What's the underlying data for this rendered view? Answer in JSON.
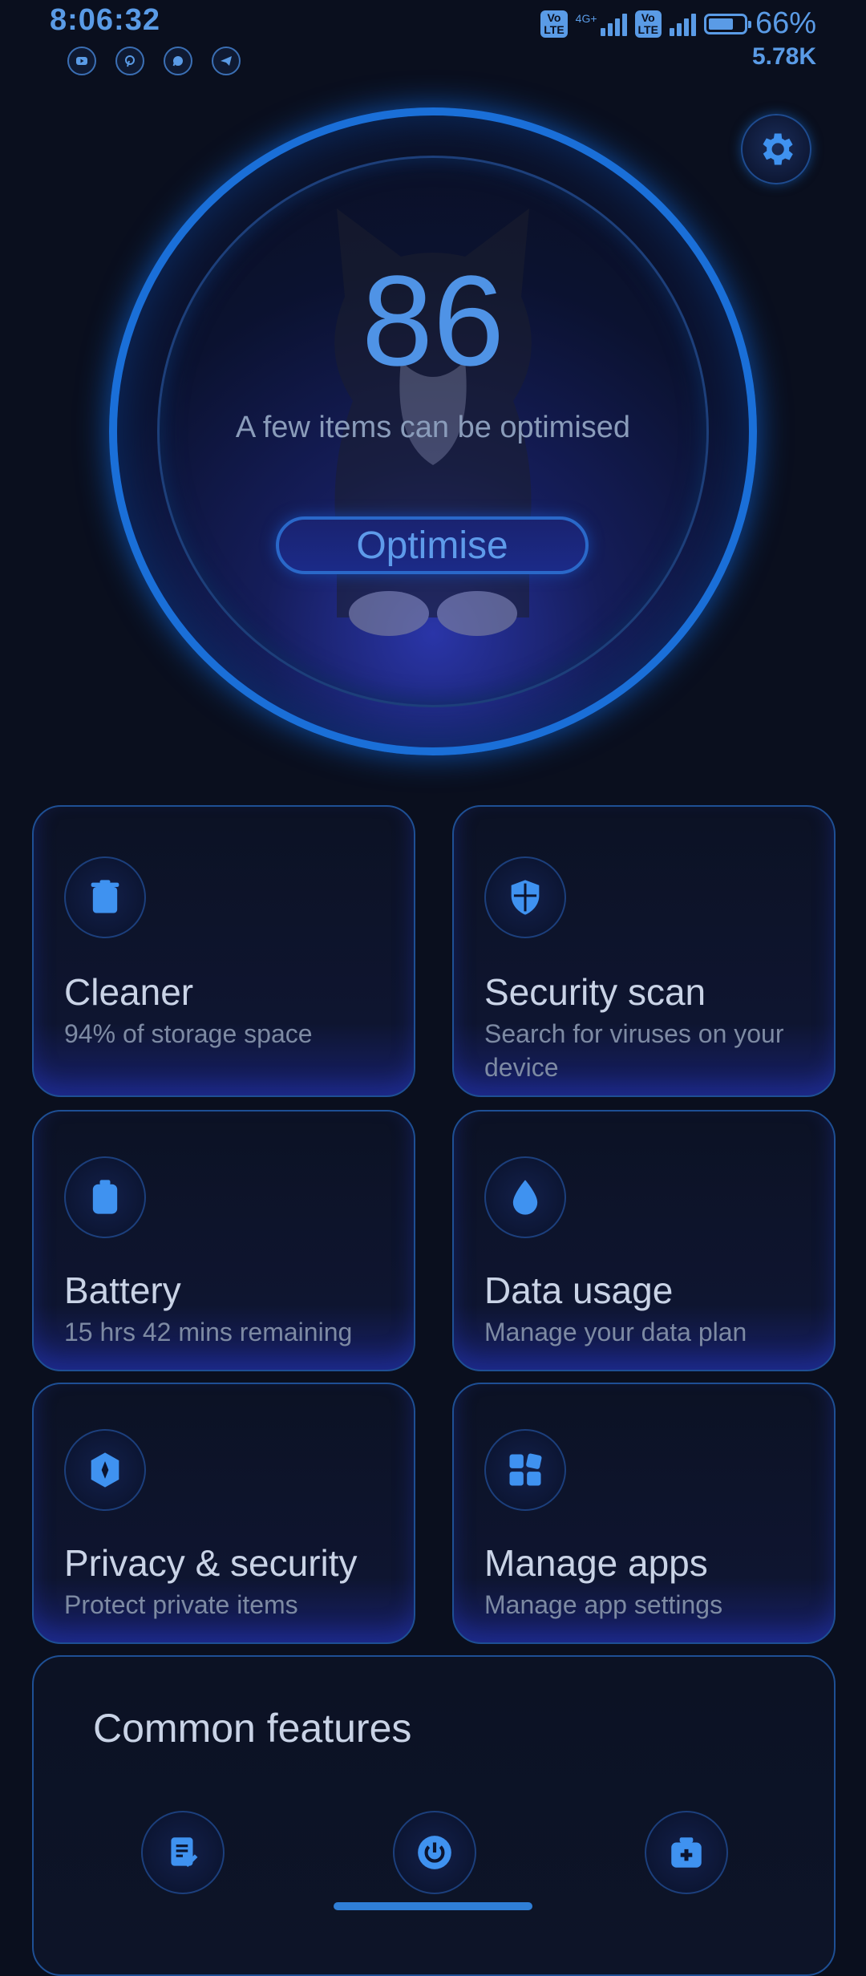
{
  "status_bar": {
    "time": "8:06:32",
    "network_type": "4G+",
    "volte_label": "Vo LTE",
    "battery_percent": "66%",
    "net_speed": "5.78K",
    "notification_icons": [
      "youtube-icon",
      "pinterest-icon",
      "whatsapp-icon",
      "telegram-icon"
    ]
  },
  "score": {
    "value": "86",
    "message": "A few items can be optimised",
    "button_label": "Optimise"
  },
  "cards": [
    {
      "title": "Cleaner",
      "subtitle": "94% of storage space",
      "icon": "trash-icon"
    },
    {
      "title": "Security scan",
      "subtitle": "Search for viruses on your device",
      "icon": "shield-icon"
    },
    {
      "title": "Battery",
      "subtitle": "15 hrs 42 mins  remaining",
      "icon": "battery-icon"
    },
    {
      "title": "Data usage",
      "subtitle": "Manage your data plan",
      "icon": "droplet-icon"
    },
    {
      "title": "Privacy & security",
      "subtitle": "Protect private items",
      "icon": "privacy-icon"
    },
    {
      "title": "Manage apps",
      "subtitle": "Manage app settings",
      "icon": "apps-grid-icon"
    }
  ],
  "common_features": {
    "title": "Common features",
    "icons": [
      "checklist-icon",
      "power-icon",
      "first-aid-icon"
    ]
  },
  "colors": {
    "accent": "#4f93e6",
    "ring": "#1a6fd8",
    "background": "#0a0f1e"
  }
}
